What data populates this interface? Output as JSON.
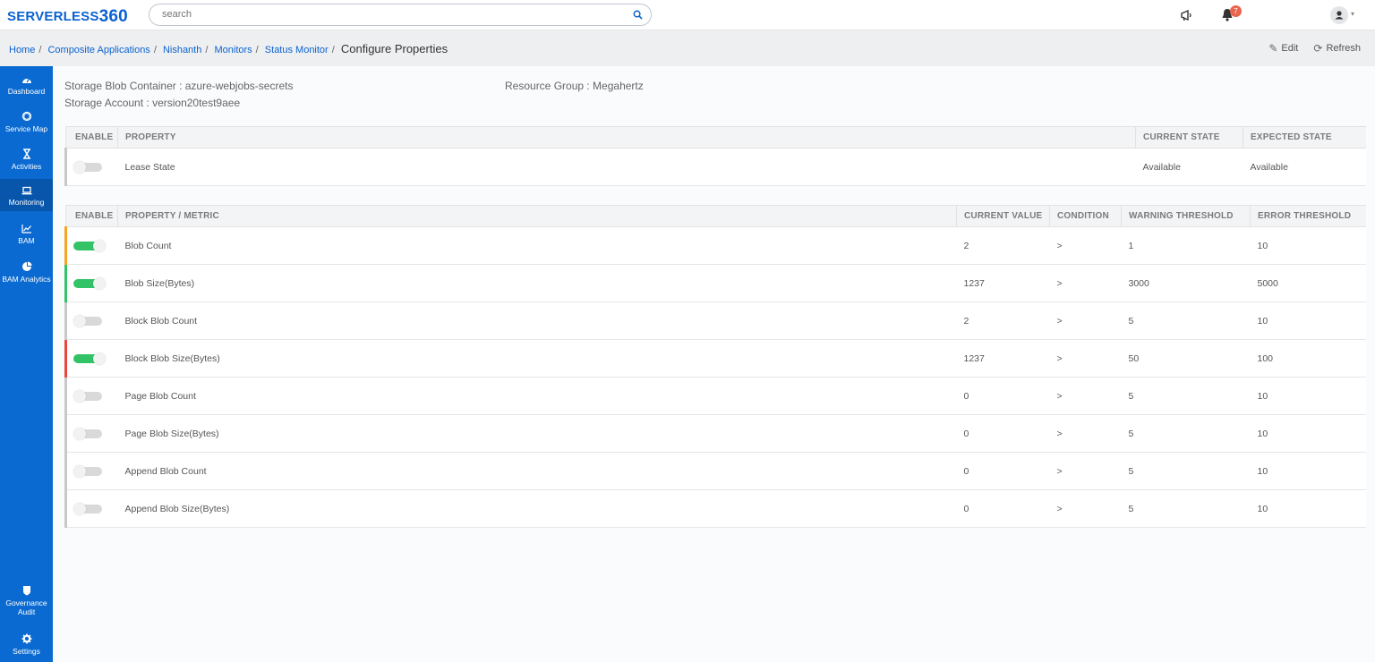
{
  "brand": {
    "text": "SERVERLESS",
    "num": "360"
  },
  "search": {
    "placeholder": "search"
  },
  "notifications": {
    "count": "7"
  },
  "breadcrumb": {
    "links": [
      "Home",
      "Composite Applications",
      "Nishanth",
      "Monitors",
      "Status Monitor"
    ],
    "current": "Configure Properties"
  },
  "header_actions": {
    "edit": "Edit",
    "refresh": "Refresh"
  },
  "sidebar": {
    "items": [
      {
        "label": "Dashboard",
        "icon": "dashboard-icon"
      },
      {
        "label": "Service Map",
        "icon": "service-map-icon"
      },
      {
        "label": "Activities",
        "icon": "hourglass-icon"
      },
      {
        "label": "Monitoring",
        "icon": "laptop-icon",
        "active": true
      },
      {
        "label": "BAM",
        "icon": "chart-line-icon"
      },
      {
        "label": "BAM Analytics",
        "icon": "pie-chart-icon"
      }
    ],
    "bottom": [
      {
        "label": "Governance Audit",
        "icon": "shield-icon"
      },
      {
        "label": "Settings",
        "icon": "gear-icon"
      }
    ]
  },
  "resource": {
    "container": "Storage Blob Container : azure-webjobs-secrets",
    "account": "Storage Account : version20test9aee",
    "group": "Resource Group : Megahertz"
  },
  "state_table": {
    "headers": [
      "ENABLE",
      "PROPERTY",
      "CURRENT STATE",
      "EXPECTED STATE"
    ],
    "rows": [
      {
        "enabled": false,
        "property": "Lease State",
        "current": "Available",
        "expected": "Available"
      }
    ]
  },
  "metric_table": {
    "headers": [
      "ENABLE",
      "PROPERTY / METRIC",
      "CURRENT VALUE",
      "CONDITION",
      "WARNING THRESHOLD",
      "ERROR THRESHOLD"
    ],
    "rows": [
      {
        "enabled": true,
        "status": "warning",
        "metric": "Blob Count",
        "value": "2",
        "condition": ">",
        "warning": "1",
        "error": "10"
      },
      {
        "enabled": true,
        "status": "healthy",
        "metric": "Blob Size(Bytes)",
        "value": "1237",
        "condition": ">",
        "warning": "3000",
        "error": "5000"
      },
      {
        "enabled": false,
        "status": "none",
        "metric": "Block Blob Count",
        "value": "2",
        "condition": ">",
        "warning": "5",
        "error": "10"
      },
      {
        "enabled": true,
        "status": "error",
        "metric": "Block Blob Size(Bytes)",
        "value": "1237",
        "condition": ">",
        "warning": "50",
        "error": "100"
      },
      {
        "enabled": false,
        "status": "none",
        "metric": "Page Blob Count",
        "value": "0",
        "condition": ">",
        "warning": "5",
        "error": "10"
      },
      {
        "enabled": false,
        "status": "none",
        "metric": "Page Blob Size(Bytes)",
        "value": "0",
        "condition": ">",
        "warning": "5",
        "error": "10"
      },
      {
        "enabled": false,
        "status": "none",
        "metric": "Append Blob Count",
        "value": "0",
        "condition": ">",
        "warning": "5",
        "error": "10"
      },
      {
        "enabled": false,
        "status": "none",
        "metric": "Append Blob Size(Bytes)",
        "value": "0",
        "condition": ">",
        "warning": "5",
        "error": "10"
      }
    ]
  },
  "colors": {
    "accent": "#0a62d0",
    "sidebar": "#0a6ad1",
    "ok": "#31c366",
    "warning": "#f4a623",
    "error": "#e8473f"
  }
}
